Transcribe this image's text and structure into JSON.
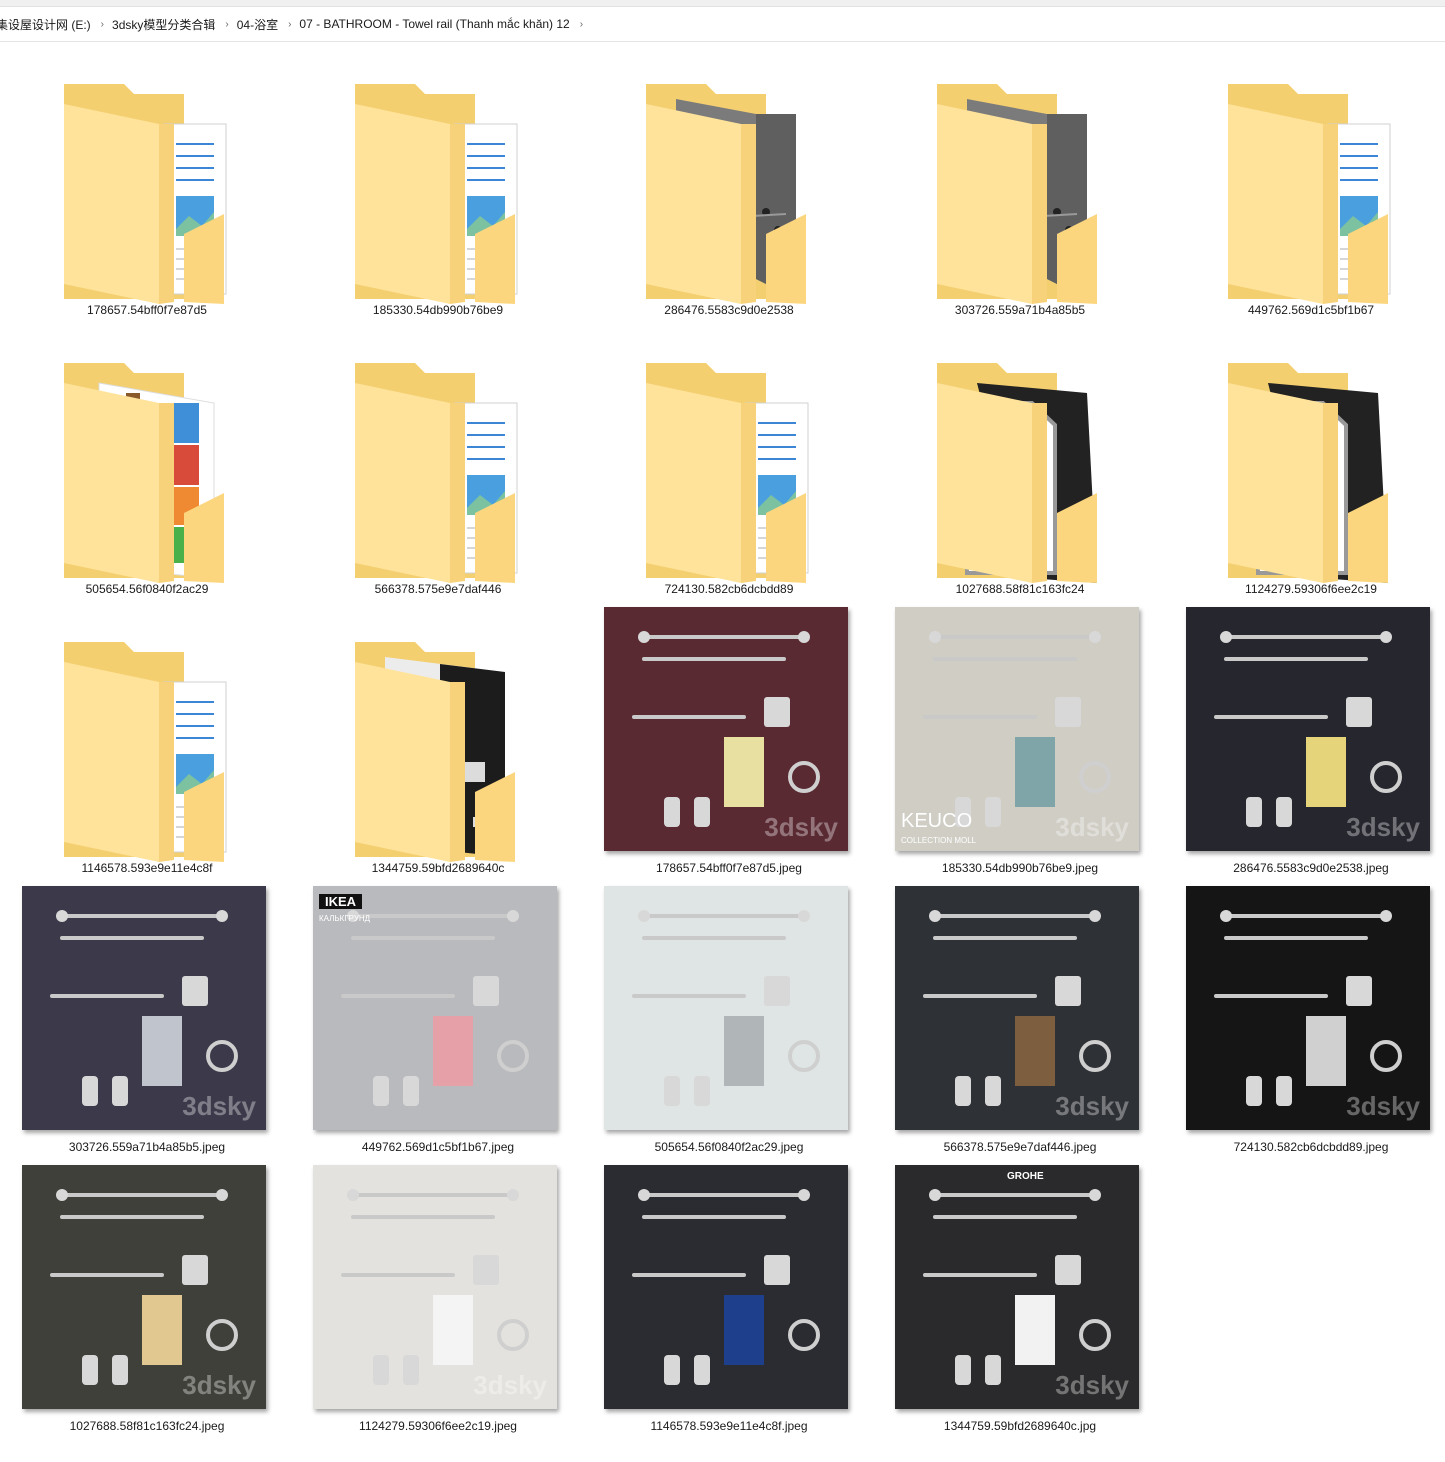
{
  "breadcrumb": {
    "items": [
      "集设屋设计网 (E:)",
      "3dsky模型分类合辑",
      "04-浴室",
      "07 - BATHROOM - Towel rail (Thanh mắc khăn) 12"
    ],
    "sep": "›"
  },
  "items": [
    {
      "name": "178657.54bff0f7e87d5",
      "kind": "folder",
      "preview": "document"
    },
    {
      "name": "185330.54db990b76be9",
      "kind": "folder",
      "preview": "document"
    },
    {
      "name": "286476.5583c9d0e2538",
      "kind": "folder",
      "preview": "gray-render"
    },
    {
      "name": "303726.559a71b4a85b5",
      "kind": "folder",
      "preview": "gray-render"
    },
    {
      "name": "449762.569d1c5bf1b67",
      "kind": "folder",
      "preview": "document"
    },
    {
      "name": "505654.56f0840f2ac29",
      "kind": "folder",
      "preview": "archive"
    },
    {
      "name": "566378.575e9e7daf446",
      "kind": "folder",
      "preview": "document"
    },
    {
      "name": "724130.582cb6dcbdd89",
      "kind": "folder",
      "preview": "document"
    },
    {
      "name": "1027688.58f81c163fc24",
      "kind": "folder",
      "preview": "3d-file"
    },
    {
      "name": "1124279.59306f6ee2c19",
      "kind": "folder",
      "preview": "3d-file"
    },
    {
      "name": "1146578.593e9e11e4c8f",
      "kind": "folder",
      "preview": "document"
    },
    {
      "name": "1344759.59bfd2689640c",
      "kind": "folder",
      "preview": "texture"
    },
    {
      "name": "178657.54bff0f7e87d5.jpeg",
      "kind": "image",
      "bg": "#5a2a33",
      "accent": "#e8e0a0",
      "watermark": "3dsky"
    },
    {
      "name": "185330.54db990b76be9.jpeg",
      "kind": "image",
      "bg": "#cfcdc4",
      "accent": "#7fa5a8",
      "brand": "KEUCO",
      "brand_sub": "COLLECTION MOLL",
      "watermark": "3dsky"
    },
    {
      "name": "286476.5583c9d0e2538.jpeg",
      "kind": "image",
      "bg": "#25262e",
      "accent": "#e6d47a",
      "watermark": "3dsky"
    },
    {
      "name": "303726.559a71b4a85b5.jpeg",
      "kind": "image",
      "bg": "#3c3a4a",
      "accent": "#c0c4cc",
      "watermark": "3dsky"
    },
    {
      "name": "449762.569d1c5bf1b67.jpeg",
      "kind": "image",
      "bg": "#b9babd",
      "accent": "#e6a0a8",
      "brand": "IKEA",
      "brand_sub": "КАЛЬКГРУНД"
    },
    {
      "name": "505654.56f0840f2ac29.jpeg",
      "kind": "image",
      "bg": "#dfe5e4",
      "accent": "#b0b6b8"
    },
    {
      "name": "566378.575e9e7daf446.jpeg",
      "kind": "image",
      "bg": "#2e3136",
      "accent": "#7d5e3f",
      "watermark": "3dsky"
    },
    {
      "name": "724130.582cb6dcbdd89.jpeg",
      "kind": "image",
      "bg": "#151515",
      "accent": "#d0d0d0",
      "watermark": "3dsky"
    },
    {
      "name": "1027688.58f81c163fc24.jpeg",
      "kind": "image",
      "bg": "#3f403a",
      "accent": "#e0c890",
      "watermark": "3dsky"
    },
    {
      "name": "1124279.59306f6ee2c19.jpeg",
      "kind": "image",
      "bg": "#e4e2de",
      "accent": "#f4f4f4",
      "watermark": "3dsky"
    },
    {
      "name": "1146578.593e9e11e4c8f.jpeg",
      "kind": "image",
      "bg": "#2b2c31",
      "accent": "#1d3f8c"
    },
    {
      "name": "1344759.59bfd2689640c.jpg",
      "kind": "image",
      "bg": "#2a2a2c",
      "accent": "#f2f2f2",
      "brand": "GROHE",
      "watermark": "3dsky"
    }
  ]
}
